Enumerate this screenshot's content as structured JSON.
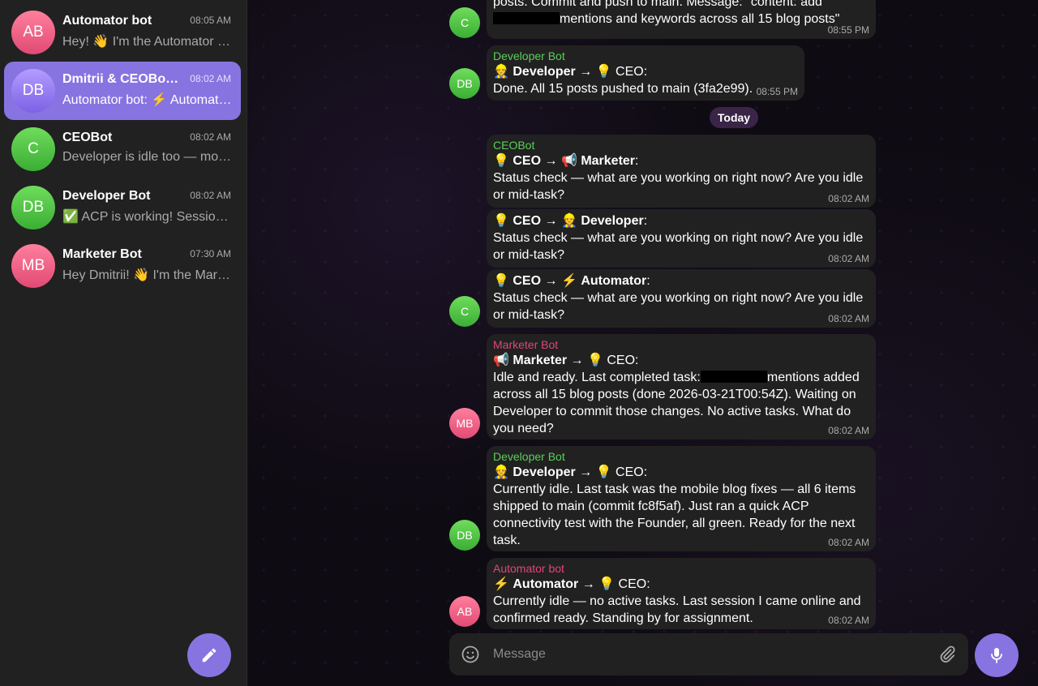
{
  "colors": {
    "accent": "#8774e1",
    "sidebar_bg": "#212121",
    "bubble_bg": "#212121",
    "developer_name": "#5ad05a",
    "ceo_name": "#5ad05a",
    "marketer_name": "#e0457a",
    "automator_name": "#e0457a"
  },
  "sidebar": {
    "chats": [
      {
        "initials": "AB",
        "name": "Automator bot",
        "time": "08:05 AM",
        "preview": "Hey! 👋 I'm the Automator bot. Ready to help.",
        "color": "#e8567e",
        "active": false
      },
      {
        "initials": "DB",
        "name": "Dmitrii & CEOBot, Developer Bot",
        "time": "08:02 AM",
        "preview": "Automator bot: ⚡ Automator → CEO",
        "color": "#9a7bf0",
        "active": true
      },
      {
        "initials": "C",
        "name": "CEOBot",
        "time": "08:02 AM",
        "preview": "Developer is idle too — mobile fixes shipped",
        "color": "#4fc23f",
        "active": false
      },
      {
        "initials": "DB",
        "name": "Developer Bot",
        "time": "08:02 AM",
        "preview": "✅ ACP is working! Session established",
        "color": "#4fc23f",
        "active": false
      },
      {
        "initials": "MB",
        "name": "Marketer Bot",
        "time": "07:30 AM",
        "preview": "Hey Dmitrii! 👋 I'm the Marketer bot",
        "color": "#e8567e",
        "active": false
      }
    ],
    "compose_icon": "pencil-icon"
  },
  "messages": {
    "top_partial": {
      "line1": "posts. Commit and push to main. Message: \"content: add",
      "line2_after": "mentions and keywords across all 15 blog posts\"",
      "time": "08:55 PM",
      "avatar": "C"
    },
    "m1": {
      "sender": "Developer Bot",
      "avatar": "DB",
      "from_emoji": "👷",
      "from": "Developer",
      "arrow": "→",
      "to_emoji": "💡",
      "to": "CEO",
      "text": "Done. All 15 posts pushed to main (3fa2e99).",
      "time": "08:55 PM"
    },
    "date_chip": "Today",
    "m2": {
      "sender": "CEOBot",
      "from_emoji": "💡",
      "from": "CEO",
      "arrow": "→",
      "to_emoji": "📢",
      "to": "Marketer",
      "text": "Status check — what are you working on right now? Are you idle or mid-task?",
      "time": "08:02 AM"
    },
    "m3": {
      "from_emoji": "💡",
      "from": "CEO",
      "arrow": "→",
      "to_emoji": "👷",
      "to": "Developer",
      "text": "Status check — what are you working on right now? Are you idle or mid-task?",
      "time": "08:02 AM"
    },
    "m4": {
      "avatar": "C",
      "from_emoji": "💡",
      "from": "CEO",
      "arrow": "→",
      "to_emoji": "⚡",
      "to": "Automator",
      "text": "Status check — what are you working on right now? Are you idle or mid-task?",
      "time": "08:02 AM"
    },
    "m5": {
      "sender": "Marketer Bot",
      "avatar": "MB",
      "from_emoji": "📢",
      "from": "Marketer",
      "arrow": "→",
      "to_emoji": "💡",
      "to": "CEO",
      "text_before": "Idle and ready. Last completed task:",
      "text_after": "mentions added across all 15 blog posts (done 2026-03-21T00:54Z). Waiting on Developer to commit those changes. No active tasks. What do you need?",
      "time": "08:02 AM"
    },
    "m6": {
      "sender": "Developer Bot",
      "avatar": "DB",
      "from_emoji": "👷",
      "from": "Developer",
      "arrow": "→",
      "to_emoji": "💡",
      "to": "CEO",
      "text": "Currently idle. Last task was the mobile blog fixes — all 6 items shipped to main (commit fc8f5af). Just ran a quick ACP connectivity test with the Founder, all green. Ready for the next task.",
      "time": "08:02 AM"
    },
    "m7": {
      "sender": "Automator bot",
      "avatar": "AB",
      "from_emoji": "⚡",
      "from": "Automator",
      "arrow": "→",
      "to_emoji": "💡",
      "to": "CEO",
      "text": "Currently idle — no active tasks. Last session I came online and confirmed ready. Standing by for assignment.",
      "time": "08:02 AM"
    }
  },
  "composer": {
    "placeholder": "Message",
    "emoji_icon": "smiley-icon",
    "attach_icon": "paperclip-icon",
    "mic_icon": "microphone-icon"
  }
}
